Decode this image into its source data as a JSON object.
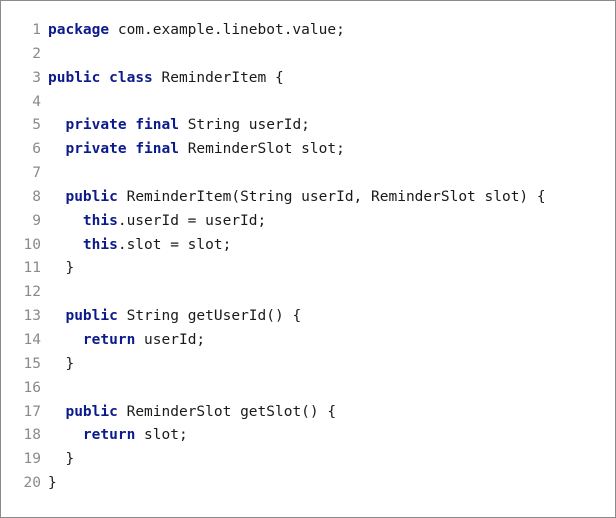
{
  "code": {
    "lines": [
      {
        "n": "1",
        "t": [
          {
            "k": true,
            "s": "package"
          },
          {
            "k": false,
            "s": " com.example.linebot.value;"
          }
        ]
      },
      {
        "n": "2",
        "t": []
      },
      {
        "n": "3",
        "t": [
          {
            "k": true,
            "s": "public"
          },
          {
            "k": false,
            "s": " "
          },
          {
            "k": true,
            "s": "class"
          },
          {
            "k": false,
            "s": " ReminderItem {"
          }
        ]
      },
      {
        "n": "4",
        "t": []
      },
      {
        "n": "5",
        "t": [
          {
            "k": false,
            "s": "  "
          },
          {
            "k": true,
            "s": "private"
          },
          {
            "k": false,
            "s": " "
          },
          {
            "k": true,
            "s": "final"
          },
          {
            "k": false,
            "s": " String userId;"
          }
        ]
      },
      {
        "n": "6",
        "t": [
          {
            "k": false,
            "s": "  "
          },
          {
            "k": true,
            "s": "private"
          },
          {
            "k": false,
            "s": " "
          },
          {
            "k": true,
            "s": "final"
          },
          {
            "k": false,
            "s": " ReminderSlot slot;"
          }
        ]
      },
      {
        "n": "7",
        "t": []
      },
      {
        "n": "8",
        "t": [
          {
            "k": false,
            "s": "  "
          },
          {
            "k": true,
            "s": "public"
          },
          {
            "k": false,
            "s": " ReminderItem(String userId, ReminderSlot slot) {"
          }
        ]
      },
      {
        "n": "9",
        "t": [
          {
            "k": false,
            "s": "    "
          },
          {
            "k": true,
            "s": "this"
          },
          {
            "k": false,
            "s": ".userId = userId;"
          }
        ]
      },
      {
        "n": "10",
        "t": [
          {
            "k": false,
            "s": "    "
          },
          {
            "k": true,
            "s": "this"
          },
          {
            "k": false,
            "s": ".slot = slot;"
          }
        ]
      },
      {
        "n": "11",
        "t": [
          {
            "k": false,
            "s": "  }"
          }
        ]
      },
      {
        "n": "12",
        "t": []
      },
      {
        "n": "13",
        "t": [
          {
            "k": false,
            "s": "  "
          },
          {
            "k": true,
            "s": "public"
          },
          {
            "k": false,
            "s": " String getUserId() {"
          }
        ]
      },
      {
        "n": "14",
        "t": [
          {
            "k": false,
            "s": "    "
          },
          {
            "k": true,
            "s": "return"
          },
          {
            "k": false,
            "s": " userId;"
          }
        ]
      },
      {
        "n": "15",
        "t": [
          {
            "k": false,
            "s": "  }"
          }
        ]
      },
      {
        "n": "16",
        "t": []
      },
      {
        "n": "17",
        "t": [
          {
            "k": false,
            "s": "  "
          },
          {
            "k": true,
            "s": "public"
          },
          {
            "k": false,
            "s": " ReminderSlot getSlot() {"
          }
        ]
      },
      {
        "n": "18",
        "t": [
          {
            "k": false,
            "s": "    "
          },
          {
            "k": true,
            "s": "return"
          },
          {
            "k": false,
            "s": " slot;"
          }
        ]
      },
      {
        "n": "19",
        "t": [
          {
            "k": false,
            "s": "  }"
          }
        ]
      },
      {
        "n": "20",
        "t": [
          {
            "k": false,
            "s": "}"
          }
        ]
      }
    ]
  },
  "colors": {
    "keyword": "#0b1a8c",
    "text": "#1a1a1a",
    "line_number": "#8a8a8a",
    "border": "#8a8a8a",
    "background": "#ffffff"
  }
}
